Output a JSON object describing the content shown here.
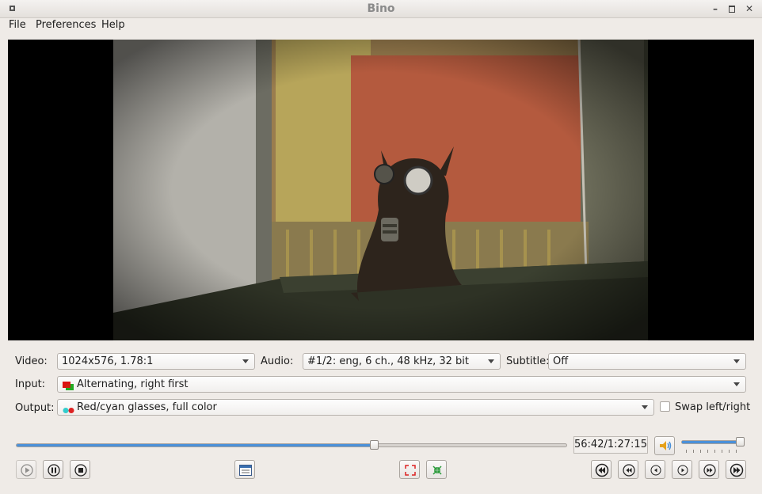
{
  "window": {
    "title": "Bino"
  },
  "menu": [
    {
      "label": "File"
    },
    {
      "label": "Preferences"
    },
    {
      "label": "Help"
    }
  ],
  "video": {
    "label": "Video:",
    "value": "1024x576, 1.78:1"
  },
  "audio": {
    "label": "Audio:",
    "value": "#1/2: eng, 6 ch., 48 kHz, 32 bit"
  },
  "subtitle": {
    "label": "Subtitle:",
    "value": "Off"
  },
  "input": {
    "label": "Input:",
    "value": "Alternating, right first"
  },
  "output": {
    "label": "Output:",
    "value": "Red/cyan glasses, full color"
  },
  "swap": {
    "label": "Swap left/right",
    "checked": false
  },
  "playback": {
    "position_fraction": 0.65,
    "time": "56:42/1:27:15",
    "volume_fraction": 0.94
  },
  "colors": {
    "accent": "#4a90d9",
    "window_bg": "#efebe7"
  },
  "icons": {
    "transport": [
      "play-icon",
      "pause-icon",
      "stop-icon",
      "fullscreen-icon",
      "center-icon",
      "restore-icon"
    ],
    "seek": [
      "seek-back-10min-icon",
      "seek-back-1min-icon",
      "seek-back-10s-icon",
      "seek-fwd-10s-icon",
      "seek-fwd-1min-icon",
      "seek-fwd-10min-icon"
    ]
  }
}
